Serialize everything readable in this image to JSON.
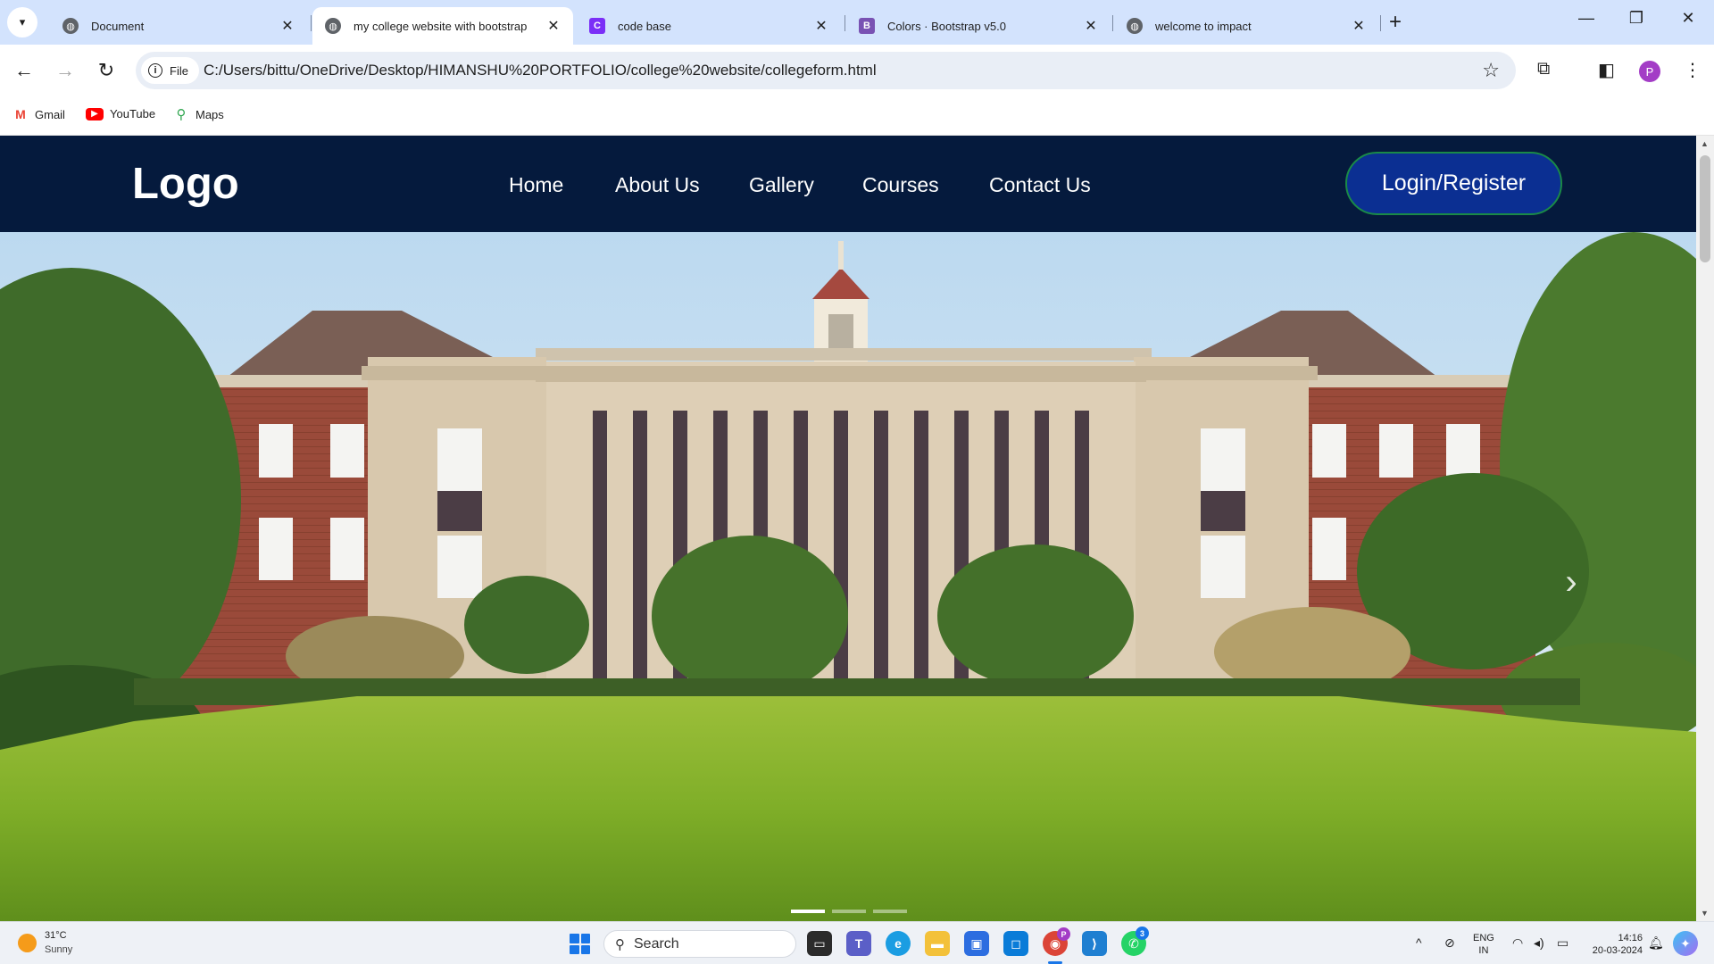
{
  "browser": {
    "tabs": [
      {
        "title": "Document",
        "icon": "globe-icon"
      },
      {
        "title": "my college website with bootstrap",
        "icon": "globe-icon",
        "active": true
      },
      {
        "title": "code base",
        "icon": "codebase-icon"
      },
      {
        "title": "Colors · Bootstrap v5.0",
        "icon": "bootstrap-icon"
      },
      {
        "title": "welcome to impact",
        "icon": "globe-icon"
      }
    ],
    "new_tab": "+",
    "window_controls": {
      "minimize": "—",
      "restore": "❐",
      "close": "✕"
    },
    "address": {
      "chip_label": "File",
      "url": "C:/Users/bittu/OneDrive/Desktop/HIMANSHU%20PORTFOLIO/college%20website/collegeform.html"
    },
    "profile_initial": "P",
    "bookmarks": [
      {
        "label": "Gmail",
        "icon": "gmail-icon"
      },
      {
        "label": "YouTube",
        "icon": "youtube-icon"
      },
      {
        "label": "Maps",
        "icon": "maps-icon"
      }
    ]
  },
  "site": {
    "logo": "Logo",
    "nav": [
      "Home",
      "About Us",
      "Gallery",
      "Courses",
      "Contact Us"
    ],
    "login_button": "Login/Register",
    "carousel": {
      "slides": 3,
      "active_slide": 1,
      "next_arrow": "›"
    }
  },
  "taskbar": {
    "weather": {
      "temp": "31°C",
      "condition": "Sunny"
    },
    "search_placeholder": "Search",
    "language": {
      "line1": "ENG",
      "line2": "IN"
    },
    "clock": {
      "time": "14:16",
      "date": "20-03-2024"
    },
    "badges": {
      "chrome": "P",
      "whatsapp": "3"
    }
  },
  "colors": {
    "site_nav_bg": "#051a3d",
    "login_button_bg": "#0b2f92",
    "login_button_border": "#1a8a47",
    "tabstrip_bg": "#d3e3fd"
  }
}
